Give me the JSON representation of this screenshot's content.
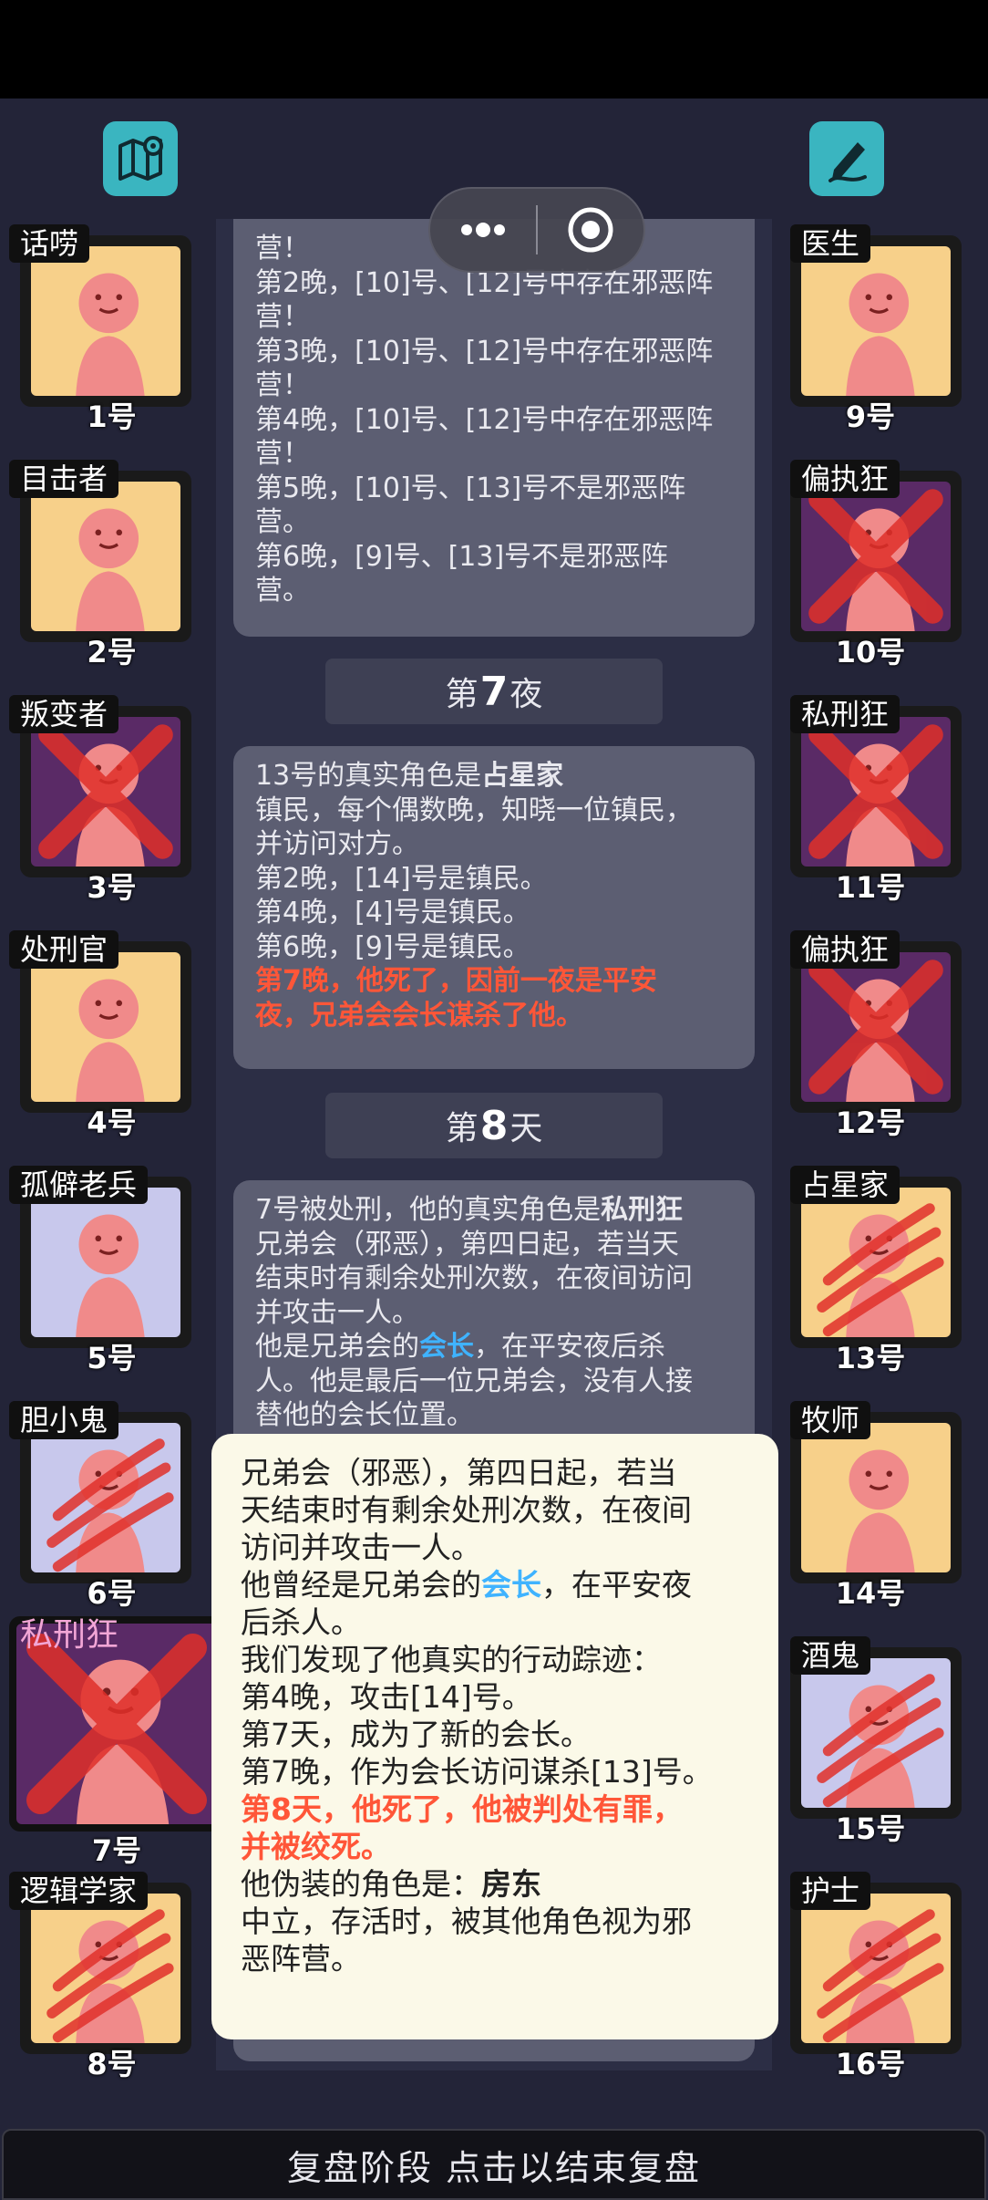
{
  "top": {
    "map_icon": "map-pin-icon",
    "notes_icon": "pen-note-icon"
  },
  "capsule": {
    "more_icon": "more-dots-icon",
    "close_icon": "target-close-icon"
  },
  "left_slots": [
    {
      "name": "话唠",
      "number": "1号",
      "bg": "#f7d08a"
    },
    {
      "name": "目击者",
      "number": "2号",
      "bg": "#f7d08a"
    },
    {
      "name": "叛变者",
      "number": "3号",
      "bg": "#5a2a66"
    },
    {
      "name": "处刑官",
      "number": "4号",
      "bg": "#f7d08a"
    },
    {
      "name": "孤僻老兵",
      "number": "5号",
      "bg": "#c8c8ec"
    },
    {
      "name": "胆小鬼",
      "number": "6号",
      "bg": "#c8c8ec"
    },
    {
      "name": "私刑狂",
      "number": "7号",
      "bg": "#5a2a66"
    },
    {
      "name": "逻辑学家",
      "number": "8号",
      "bg": "#f7d08a"
    }
  ],
  "right_slots": [
    {
      "name": "医生",
      "number": "9号",
      "bg": "#f7d08a"
    },
    {
      "name": "偏执狂",
      "number": "10号",
      "bg": "#5a2a66"
    },
    {
      "name": "私刑狂",
      "number": "11号",
      "bg": "#5a2a66"
    },
    {
      "name": "偏执狂",
      "number": "12号",
      "bg": "#5a2a66"
    },
    {
      "name": "占星家",
      "number": "13号",
      "bg": "#f7d08a"
    },
    {
      "name": "牧师",
      "number": "14号",
      "bg": "#f7d08a"
    },
    {
      "name": "酒鬼",
      "number": "15号",
      "bg": "#c8c8ec"
    },
    {
      "name": "护士",
      "number": "16号",
      "bg": "#f7d08a"
    }
  ],
  "card1": {
    "lines": [
      "营！",
      "第2晚，[10]号、[12]号中存在邪恶阵",
      "营！",
      "第3晚，[10]号、[12]号中存在邪恶阵",
      "营！",
      "第4晚，[10]号、[12]号中存在邪恶阵",
      "营！",
      "第5晚，[10]号、[13]号不是邪恶阵",
      "营。",
      "第6晚，[9]号、[13]号不是邪恶阵",
      "营。"
    ]
  },
  "header7": {
    "prefix": "第",
    "num": "7",
    "suffix": "夜"
  },
  "card2": {
    "line1_pre": "13号的真实角色是",
    "line1_role": "占星家",
    "lines": [
      "镇民，每个偶数晚，知晓一位镇民，",
      "并访问对方。",
      "第2晚，[14]号是镇民。",
      "第4晚，[4]号是镇民。",
      "第6晚，[9]号是镇民。"
    ],
    "red1": "第7晚，他死了，因前一夜是平安",
    "red2": "夜，兄弟会会长谋杀了他。"
  },
  "header8": {
    "prefix": "第",
    "num": "8",
    "suffix": "天"
  },
  "card3": {
    "line1_pre": "7号被处刑，他的真实角色是",
    "line1_role": "私刑狂",
    "lines": [
      "兄弟会（邪恶），第四日起，若当天",
      "结束时有剩余处刑次数，在夜间访问",
      "并攻击一人。"
    ],
    "line5_pre": "他是兄弟会的",
    "line5_blue": "会长",
    "line5_post": "，在平安夜后杀",
    "line6": "人。他是最后一位兄弟会，没有人接",
    "line7": "替他的会长位置。"
  },
  "popup": {
    "lines_a": [
      "兄弟会（邪恶），第四日起，若当",
      "天结束时有剩余处刑次数，在夜间",
      "访问并攻击一人。"
    ],
    "line_b_pre": "他曾经是兄弟会的",
    "line_b_blue": "会长",
    "line_b_post": "，在平安夜",
    "lines_c": [
      "后杀人。",
      "我们发现了他真实的行动踪迹：",
      "第4晚，攻击[14]号。",
      "第7天，成为了新的会长。",
      "第7晚，作为会长访问谋杀[13]号。"
    ],
    "red1": "第8天，他死了，他被判处有罪，",
    "red2": "并被绞死。",
    "fake_pre": "他伪装的角色是：",
    "fake_role": "房东",
    "lines_d": [
      "中立，存活时，被其他角色视为邪",
      "恶阵营。"
    ]
  },
  "bottom": {
    "text": "复盘阶段 点击以结束复盘"
  }
}
